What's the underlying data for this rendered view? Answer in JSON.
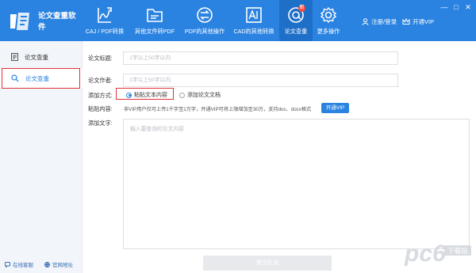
{
  "app": {
    "title": "论文查重软件"
  },
  "nav": [
    {
      "label": "CAJ / PDF转换",
      "icon": "pdf-convert-icon"
    },
    {
      "label": "其他文件转PDF",
      "icon": "folder-icon"
    },
    {
      "label": "PDF的其他操作",
      "icon": "swap-icon"
    },
    {
      "label": "CAD的其他转换",
      "icon": "cad-icon"
    },
    {
      "label": "论文查重",
      "icon": "paper-check-icon",
      "badge": "新",
      "active": true
    },
    {
      "label": "更多操作",
      "icon": "gear-icon"
    }
  ],
  "header": {
    "login": "注册/登录",
    "vip": "开通VIP"
  },
  "window_controls": [
    "—",
    "□",
    "✕"
  ],
  "sidebar": {
    "items": [
      {
        "label": "论文查重",
        "icon": "document-icon"
      },
      {
        "label": "论文查重",
        "icon": "search-icon",
        "active": true
      }
    ],
    "service": "在线客服",
    "website": "官网地址"
  },
  "form": {
    "title_label": "论文标题:",
    "title_placeholder": "1字以上50字以内",
    "author_label": "论文作者:",
    "author_placeholder": "1字以上50字以内",
    "method_label": "添加方式:",
    "method_paste": "粘贴文本内容",
    "method_upload": "添加论文文档",
    "paste_label": "粘贴内容:",
    "paste_note": "非VIP用户仅可上传1千字至1万字，开通VIP可将上限增加至30万，支持doc、docx格式",
    "vip_button": "开通VIP",
    "text_label": "添加文字:",
    "text_placeholder": "输入要查询的论文内容",
    "submit": "提交检测"
  },
  "watermark": {
    "brand": "pc6",
    "sub": "下载站"
  },
  "colors": {
    "primary": "#2b83e1",
    "highlight": "#e0333a"
  }
}
